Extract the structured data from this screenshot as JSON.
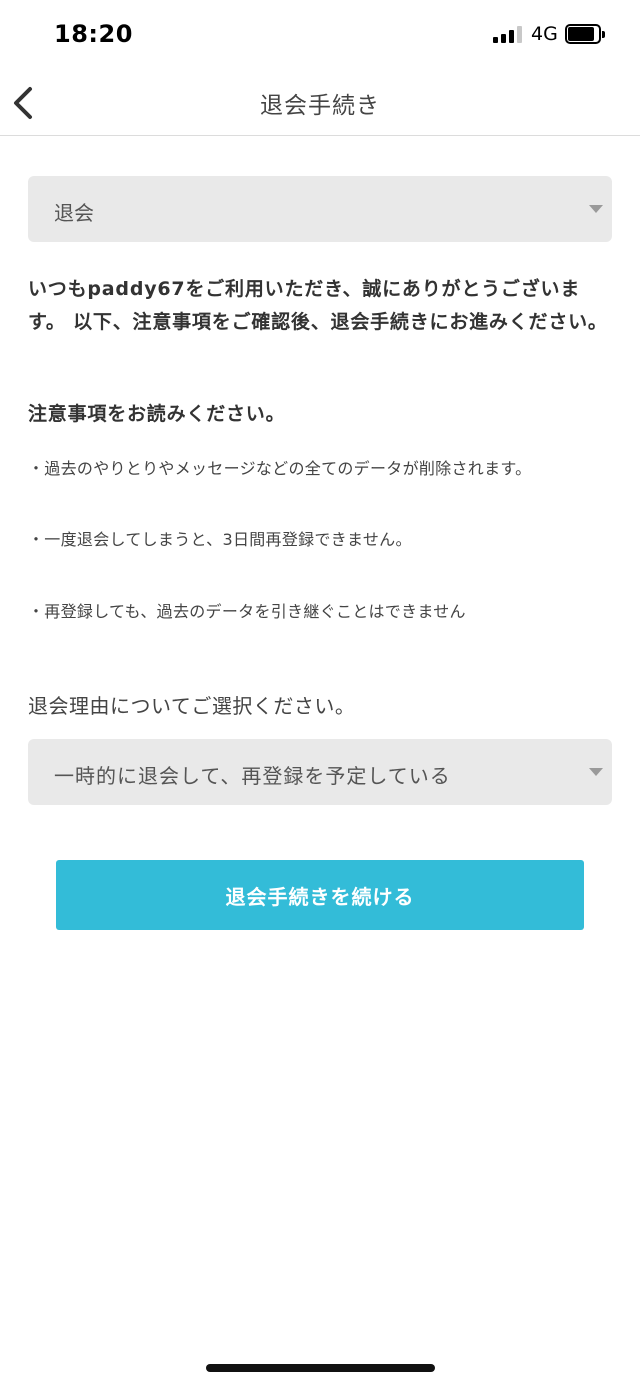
{
  "status_bar": {
    "time": "18:20",
    "network": "4G",
    "icons": [
      "signal-icon",
      "battery-icon"
    ]
  },
  "nav": {
    "title": "退会手続き",
    "back_icon": "chevron-left-icon"
  },
  "top_select": {
    "value": "退会"
  },
  "intro_text": "いつもpaddy67をご利用いただき、誠にありがとうございます。 以下、注意事項をご確認後、退会手続きにお進みください。",
  "notice": {
    "heading": "注意事項をお読みください。",
    "items": [
      "・過去のやりとりやメッセージなどの全てのデータが削除されます。",
      "・一度退会してしまうと、3日間再登録できません。",
      "・再登録しても、過去のデータを引き継ぐことはできません"
    ]
  },
  "reason": {
    "label": "退会理由についてご選択ください。",
    "selected": "一時的に退会して、再登録を予定している"
  },
  "continue_button": {
    "label": "退会手続きを続ける",
    "color": "#33bcd8"
  }
}
